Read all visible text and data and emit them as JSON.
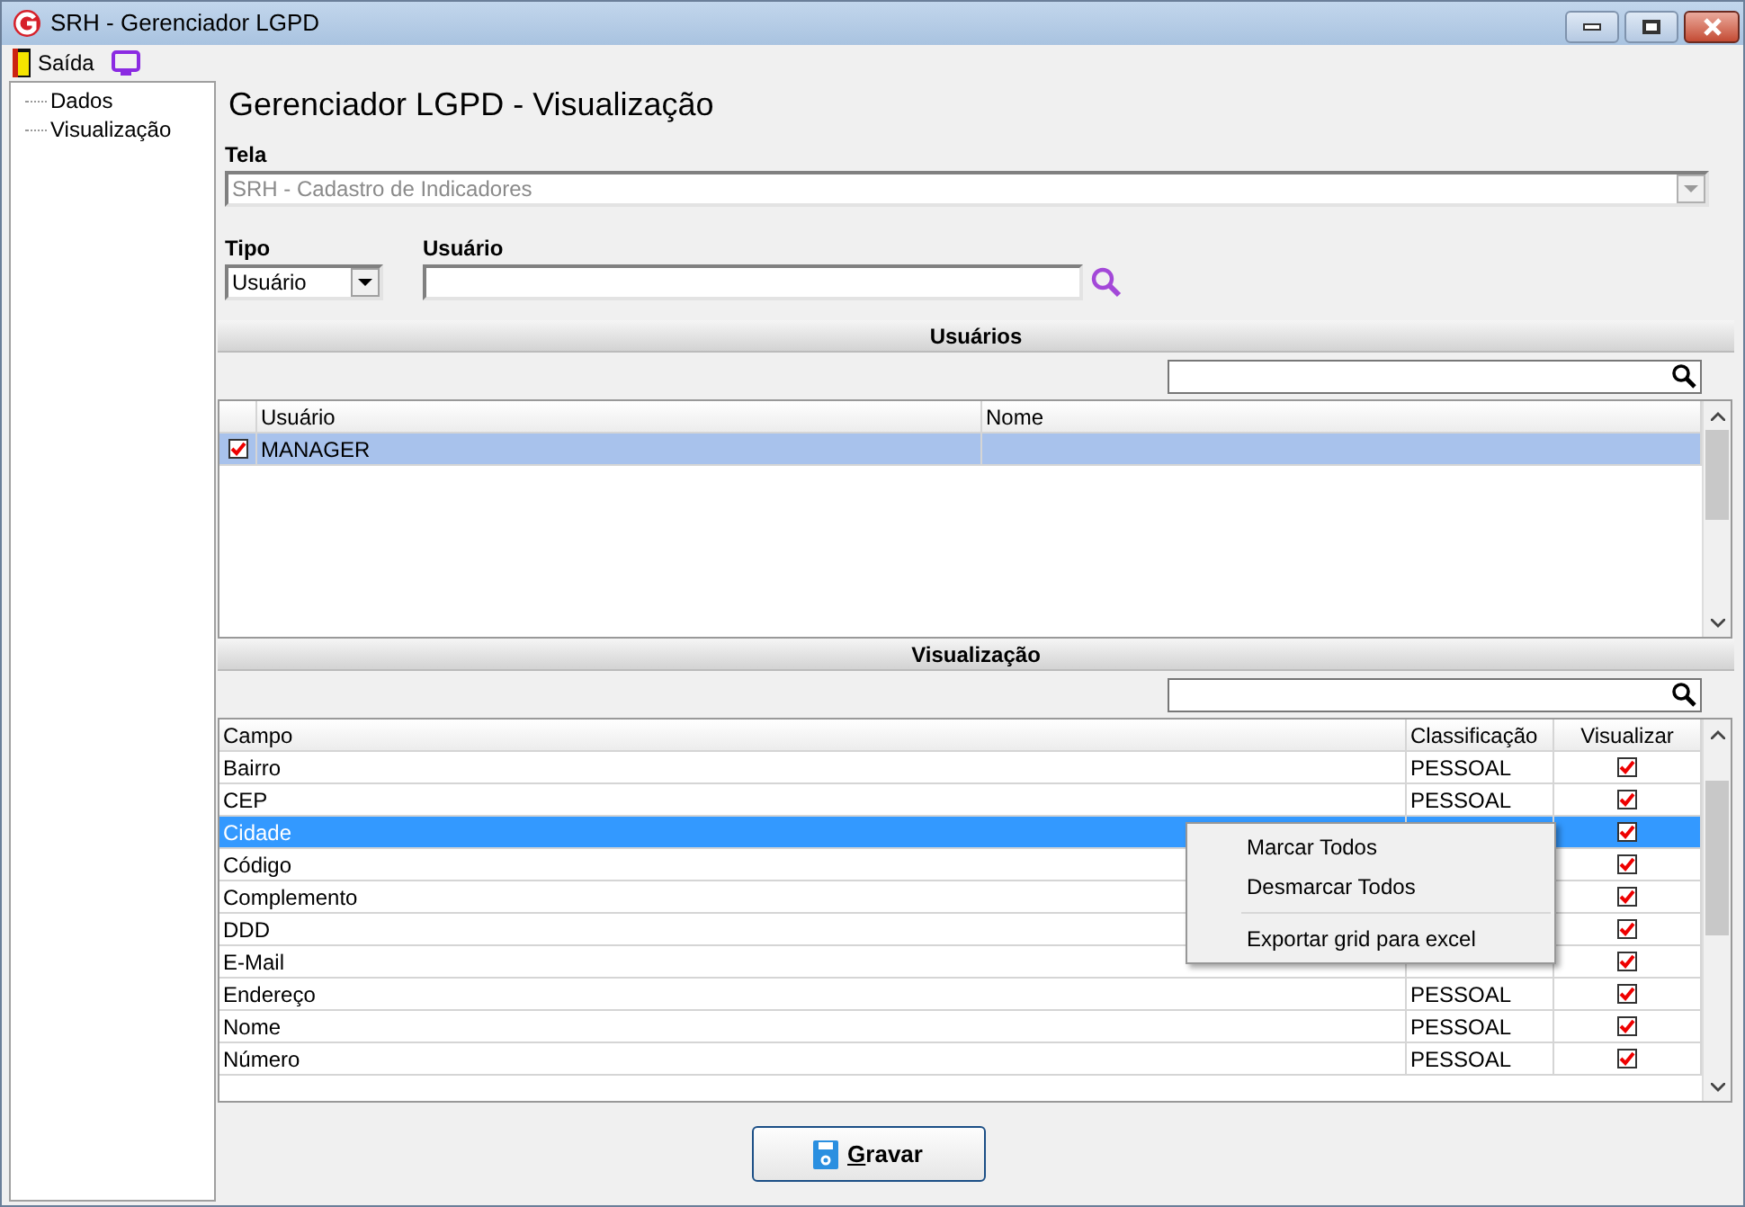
{
  "window": {
    "title": "SRH - Gerenciador LGPD"
  },
  "menu": [
    {
      "label": "Saída"
    }
  ],
  "tree": [
    {
      "label": "Dados"
    },
    {
      "label": "Visualização"
    }
  ],
  "heading": "Gerenciador LGPD - Visualização",
  "tela": {
    "label": "Tela",
    "value": "SRH - Cadastro de Indicadores",
    "disabled": true
  },
  "tipo": {
    "label": "Tipo",
    "value": "Usuário"
  },
  "usuario": {
    "label": "Usuário"
  },
  "users_section": {
    "title": "Usuários",
    "columns": [
      "Usuário",
      "Nome"
    ],
    "rows": [
      {
        "usuario": "MANAGER",
        "checked": true,
        "selected": true
      }
    ]
  },
  "view_section": {
    "title": "Visualização",
    "columns": [
      "Campo",
      "Classificação",
      "Visualizar"
    ],
    "rows": [
      {
        "campo": "Bairro",
        "classificacao": "PESSOAL",
        "checked": true,
        "selected": false
      },
      {
        "campo": "CEP",
        "classificacao": "PESSOAL",
        "checked": true,
        "selected": false
      },
      {
        "campo": "Cidade",
        "checked": true,
        "selected": true
      },
      {
        "campo": "Código",
        "checked": true,
        "selected": false
      },
      {
        "campo": "Complemento",
        "checked": true,
        "selected": false
      },
      {
        "campo": "DDD",
        "checked": true,
        "selected": false
      },
      {
        "campo": "E-Mail",
        "checked": true,
        "selected": false
      },
      {
        "campo": "Endereço",
        "classificacao": "PESSOAL",
        "checked": true,
        "selected": false
      },
      {
        "campo": "Nome",
        "classificacao": "PESSOAL",
        "checked": true,
        "selected": false
      },
      {
        "campo": "Número",
        "classificacao": "PESSOAL",
        "checked": true,
        "selected": false
      }
    ]
  },
  "context_menu": [
    {
      "label": "Marcar Todos",
      "kind": "item"
    },
    {
      "label": "Desmarcar Todos",
      "kind": "item"
    },
    {
      "kind": "separator"
    },
    {
      "label": "Exportar grid para excel",
      "kind": "item"
    }
  ],
  "save_button": {
    "label": "Gravar",
    "underline_first": true
  }
}
